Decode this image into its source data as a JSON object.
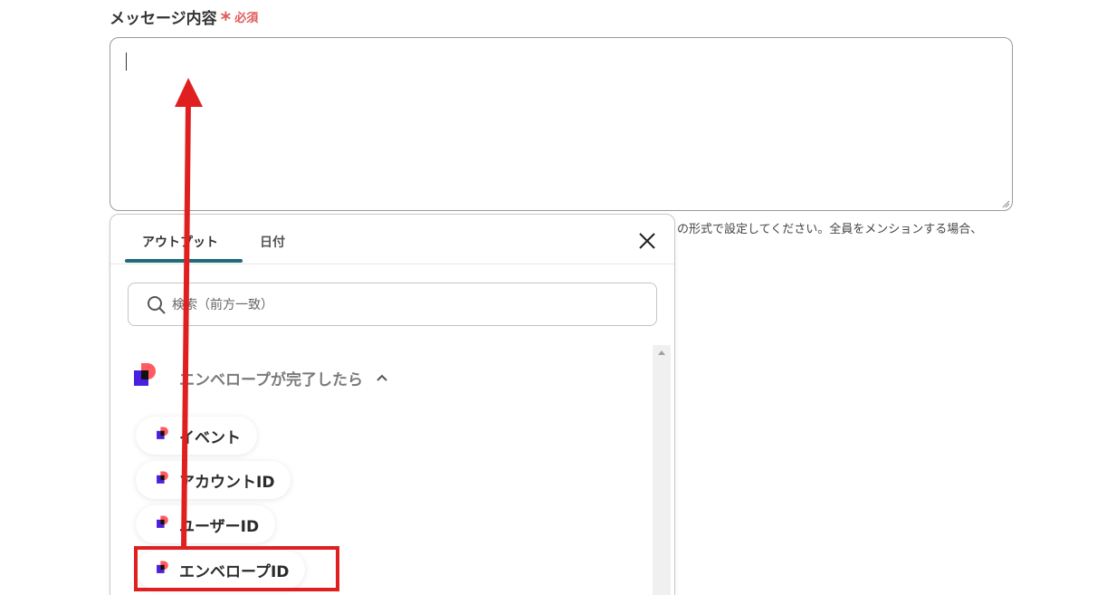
{
  "field": {
    "label": "メッセージ内容",
    "required_mark": "*",
    "required_text": "必須"
  },
  "hint": {
    "text": "の形式で設定してください。全員をメンションする場合、"
  },
  "popup": {
    "tabs": [
      {
        "label": "アウトプット",
        "active": true
      },
      {
        "label": "日付",
        "active": false
      }
    ],
    "search_placeholder": "検索（前方一致）",
    "group": {
      "title": "エンベロープが完了したら",
      "expanded": true
    },
    "items": [
      {
        "label": "イベント"
      },
      {
        "label": "アカウントID"
      },
      {
        "label": "ユーザーID"
      },
      {
        "label": "エンベロープID"
      }
    ]
  },
  "colors": {
    "required": "#e05a5a",
    "tab_accent": "#1f6b7a",
    "annotation_red": "#e02020",
    "logo_coral": "#ff5a5f",
    "logo_purple": "#4b1fe0"
  },
  "icons": {
    "search": "search-icon",
    "close": "close-icon",
    "chevron": "chevron-up-icon",
    "app_logo": "app-logo-icon"
  }
}
